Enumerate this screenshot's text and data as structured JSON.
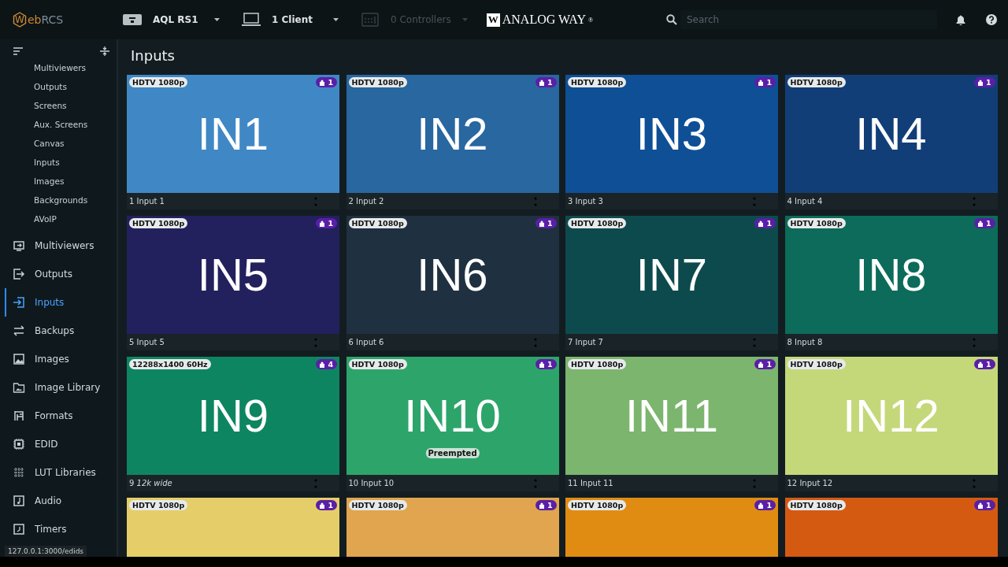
{
  "topbar": {
    "logo": {
      "letter": "W",
      "accent": "eb",
      "rest": "RCS"
    },
    "device": {
      "label": "AQL RS1"
    },
    "clients": {
      "label": "1 Client"
    },
    "controllers": {
      "label": "0 Controllers",
      "disabled": true
    },
    "brand": {
      "mark": "W",
      "name": "ANALOG WAY",
      "sup": "®"
    },
    "search": {
      "placeholder": "Search"
    }
  },
  "sidebar": {
    "submenu": [
      "Multiviewers",
      "Outputs",
      "Screens",
      "Aux. Screens",
      "Canvas",
      "Inputs",
      "Images",
      "Backgrounds",
      "AVoIP"
    ],
    "items": [
      {
        "label": "Multiviewers",
        "kind": "monitor",
        "selected": false
      },
      {
        "label": "Outputs",
        "kind": "output",
        "selected": false
      },
      {
        "label": "Inputs",
        "kind": "input",
        "selected": true
      },
      {
        "label": "Backups",
        "kind": "swap",
        "selected": false
      },
      {
        "label": "Images",
        "kind": "image",
        "selected": false
      },
      {
        "label": "Image Library",
        "kind": "folder",
        "selected": false
      },
      {
        "label": "Formats",
        "kind": "formats",
        "selected": false
      },
      {
        "label": "EDID",
        "kind": "chip",
        "selected": false
      },
      {
        "label": "LUT Libraries",
        "kind": "grid",
        "selected": false
      },
      {
        "label": "Audio",
        "kind": "note",
        "selected": false
      },
      {
        "label": "Timers",
        "kind": "clock",
        "selected": false
      }
    ],
    "status_url": "127.0.0.1:3000/edids"
  },
  "page_title": "Inputs",
  "tiles": [
    {
      "format": "HDTV 1080p",
      "count": "1",
      "preview": "IN1",
      "caption": "1 Input 1",
      "color": "#3f88c5"
    },
    {
      "format": "HDTV 1080p",
      "count": "1",
      "preview": "IN2",
      "caption": "2 Input 2",
      "color": "#2867a0"
    },
    {
      "format": "HDTV 1080p",
      "count": "1",
      "preview": "IN3",
      "caption": "3 Input 3",
      "color": "#0f4f96"
    },
    {
      "format": "HDTV 1080p",
      "count": "1",
      "preview": "IN4",
      "caption": "4 Input 4",
      "color": "#123e78"
    },
    {
      "format": "HDTV 1080p",
      "count": "1",
      "preview": "IN5",
      "caption": "5 Input 5",
      "color": "#23205e"
    },
    {
      "format": "HDTV 1080p",
      "count": "1",
      "preview": "IN6",
      "caption": "6 Input 6",
      "color": "#1f3040"
    },
    {
      "format": "HDTV 1080p",
      "count": "1",
      "preview": "IN7",
      "caption": "7 Input 7",
      "color": "#0d4a4d"
    },
    {
      "format": "HDTV 1080p",
      "count": "1",
      "preview": "IN8",
      "caption": "8 Input 8",
      "color": "#0c6b5a"
    },
    {
      "format": "12288x1400 60Hz",
      "count": "4",
      "preview": "IN9",
      "caption": "9 *12k wide*",
      "color": "#0e8561"
    },
    {
      "format": "HDTV 1080p",
      "count": "1",
      "preview": "IN10",
      "caption": "10 Input 10",
      "color": "#2da56a",
      "status": "Preempted"
    },
    {
      "format": "HDTV 1080p",
      "count": "1",
      "preview": "IN11",
      "caption": "11 Input 11",
      "color": "#7cb56e"
    },
    {
      "format": "HDTV 1080p",
      "count": "1",
      "preview": "IN12",
      "caption": "12 Input 12",
      "color": "#c4d87a"
    },
    {
      "format": "HDTV 1080p",
      "count": "1",
      "color": "#e5ce6a"
    },
    {
      "format": "HDTV 1080p",
      "count": "1",
      "color": "#e0a54e"
    },
    {
      "format": "HDTV 1080p",
      "count": "1",
      "color": "#e08c12"
    },
    {
      "format": "HDTV 1080p",
      "count": "1",
      "color": "#d45a12"
    }
  ]
}
